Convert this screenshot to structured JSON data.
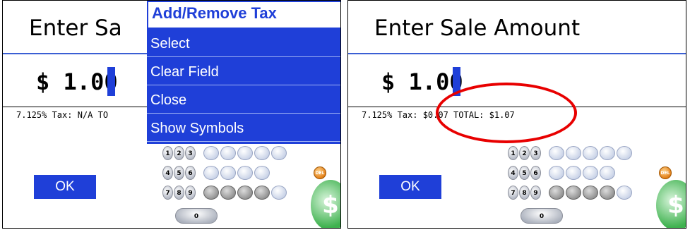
{
  "left": {
    "title": "Enter Sa",
    "amount": "$ 1.00",
    "tax_line": "7.125% Tax: N/A  TO",
    "ok_label": "OK",
    "menu": [
      {
        "label": "Add/Remove Tax",
        "selected": true
      },
      {
        "label": "Select",
        "selected": false
      },
      {
        "label": "Clear Field",
        "selected": false
      },
      {
        "label": "Close",
        "selected": false
      },
      {
        "label": "Show Symbols",
        "selected": false
      }
    ]
  },
  "right": {
    "title": "Enter Sale Amount",
    "amount": "$ 1.00",
    "tax_line": "7.125% Tax: $0.07  TOTAL: $1.07",
    "ok_label": "OK",
    "highlight_color": "#e80000"
  },
  "keypad": {
    "row1": [
      "1",
      "2",
      "3"
    ],
    "row2": [
      "4",
      "5",
      "6"
    ],
    "row3": [
      "7",
      "8",
      "9"
    ],
    "zero": "0",
    "del": "DEL",
    "dollar_sign": "$"
  },
  "colors": {
    "accent": "#1f3fd8",
    "menu_bg": "#1f3fd8",
    "menu_text": "#ffffff",
    "highlight": "#e80000"
  }
}
